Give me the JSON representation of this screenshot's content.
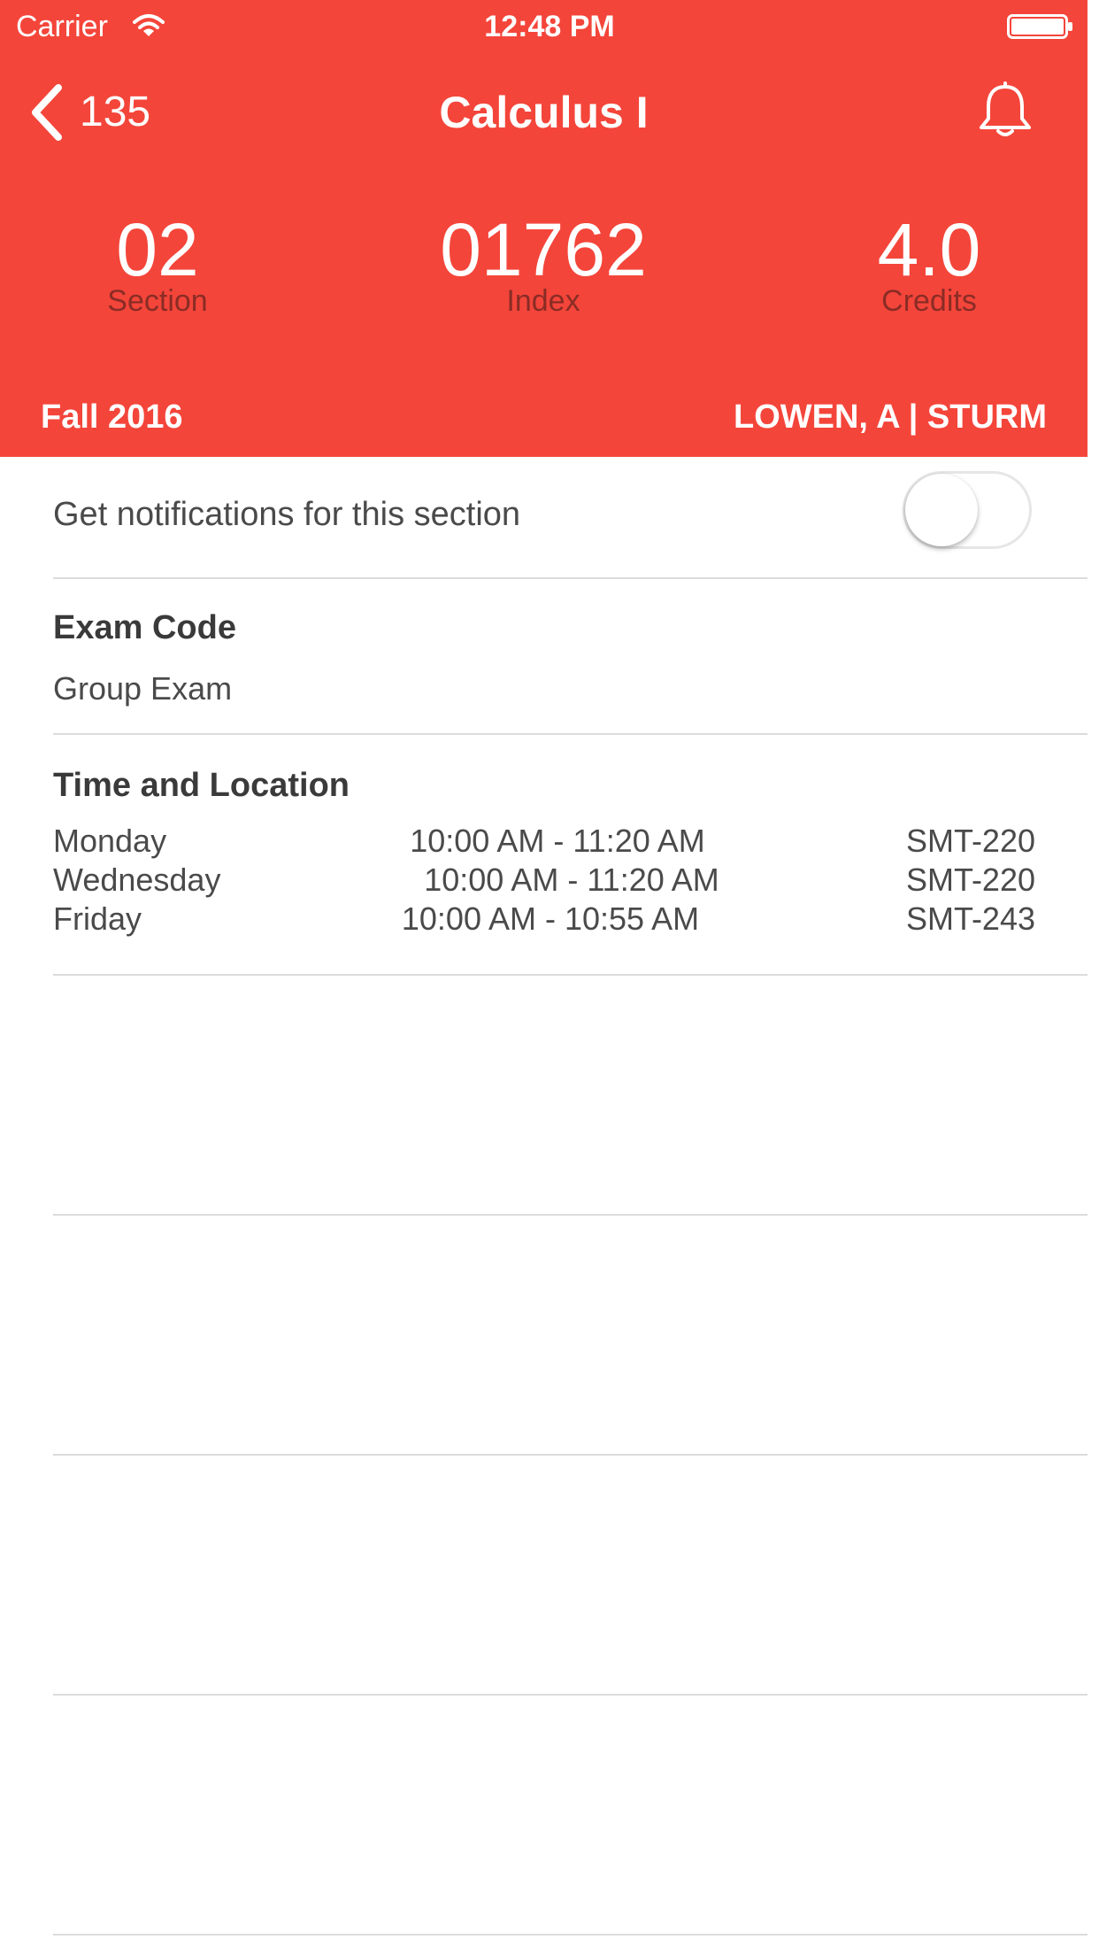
{
  "status_bar": {
    "carrier": "Carrier",
    "time": "12:48 PM"
  },
  "nav": {
    "back_label": "135",
    "title": "Calculus I"
  },
  "stats": {
    "section": {
      "value": "02",
      "label": "Section"
    },
    "index": {
      "value": "01762",
      "label": "Index"
    },
    "credits": {
      "value": "4.0",
      "label": "Credits"
    }
  },
  "term": "Fall 2016",
  "instructors": "LOWEN, A | STURM",
  "notifications": {
    "label": "Get notifications for this section",
    "enabled": false
  },
  "exam": {
    "title": "Exam Code",
    "value": "Group Exam"
  },
  "time_location": {
    "title": "Time and Location",
    "rows": [
      {
        "day": "Monday",
        "time": "10:00 AM - 11:20 AM",
        "room": "SMT-220"
      },
      {
        "day": "Wednesday",
        "time": "10:00 AM - 11:20 AM",
        "room": "SMT-220"
      },
      {
        "day": "Friday",
        "time": "10:00 AM - 10:55 AM",
        "room": "SMT-243"
      }
    ]
  },
  "colors": {
    "header_bg": "#f4453a",
    "stat_label": "#8a2c25"
  },
  "icons": {
    "wifi": "wifi-icon",
    "battery": "battery-icon",
    "back": "chevron-left-icon",
    "bell": "bell-icon"
  }
}
